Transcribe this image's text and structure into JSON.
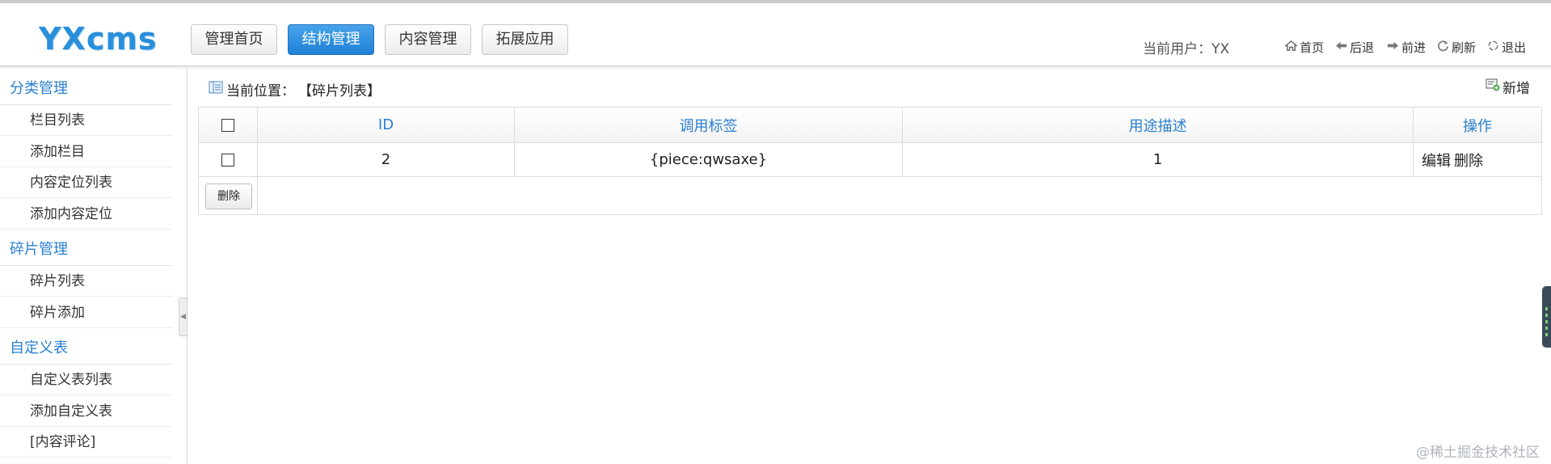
{
  "header": {
    "logo": "YXcms",
    "nav": [
      {
        "label": "管理首页",
        "active": false
      },
      {
        "label": "结构管理",
        "active": true
      },
      {
        "label": "内容管理",
        "active": false
      },
      {
        "label": "拓展应用",
        "active": false
      }
    ],
    "current_user": "当前用户：YX",
    "tools": [
      {
        "label": "首页",
        "icon": "home-icon"
      },
      {
        "label": "后退",
        "icon": "back-arrow-icon"
      },
      {
        "label": "前进",
        "icon": "forward-arrow-icon"
      },
      {
        "label": "刷新",
        "icon": "refresh-icon"
      },
      {
        "label": "退出",
        "icon": "logout-icon"
      }
    ],
    "accent_color": "#2a8fdb"
  },
  "sidebar": {
    "groups": [
      {
        "title": "分类管理",
        "items": [
          "栏目列表",
          "添加栏目",
          "内容定位列表",
          "添加内容定位"
        ]
      },
      {
        "title": "碎片管理",
        "items": [
          "碎片列表",
          "碎片添加"
        ]
      },
      {
        "title": "自定义表",
        "items": [
          "自定义表列表",
          "添加自定义表",
          "[内容评论]"
        ]
      }
    ]
  },
  "main": {
    "breadcrumb_label": "当前位置：",
    "breadcrumb_value": "【碎片列表】",
    "add_label": "新增",
    "table": {
      "headers": [
        "ID",
        "调用标签",
        "用途描述",
        "操作"
      ],
      "rows": [
        {
          "id": "2",
          "tag": "{piece:qwsaxe}",
          "desc": "1",
          "edit": "编辑",
          "delete": "删除"
        }
      ]
    },
    "delete_button": "删除"
  },
  "watermark": "@稀土掘金技术社区"
}
